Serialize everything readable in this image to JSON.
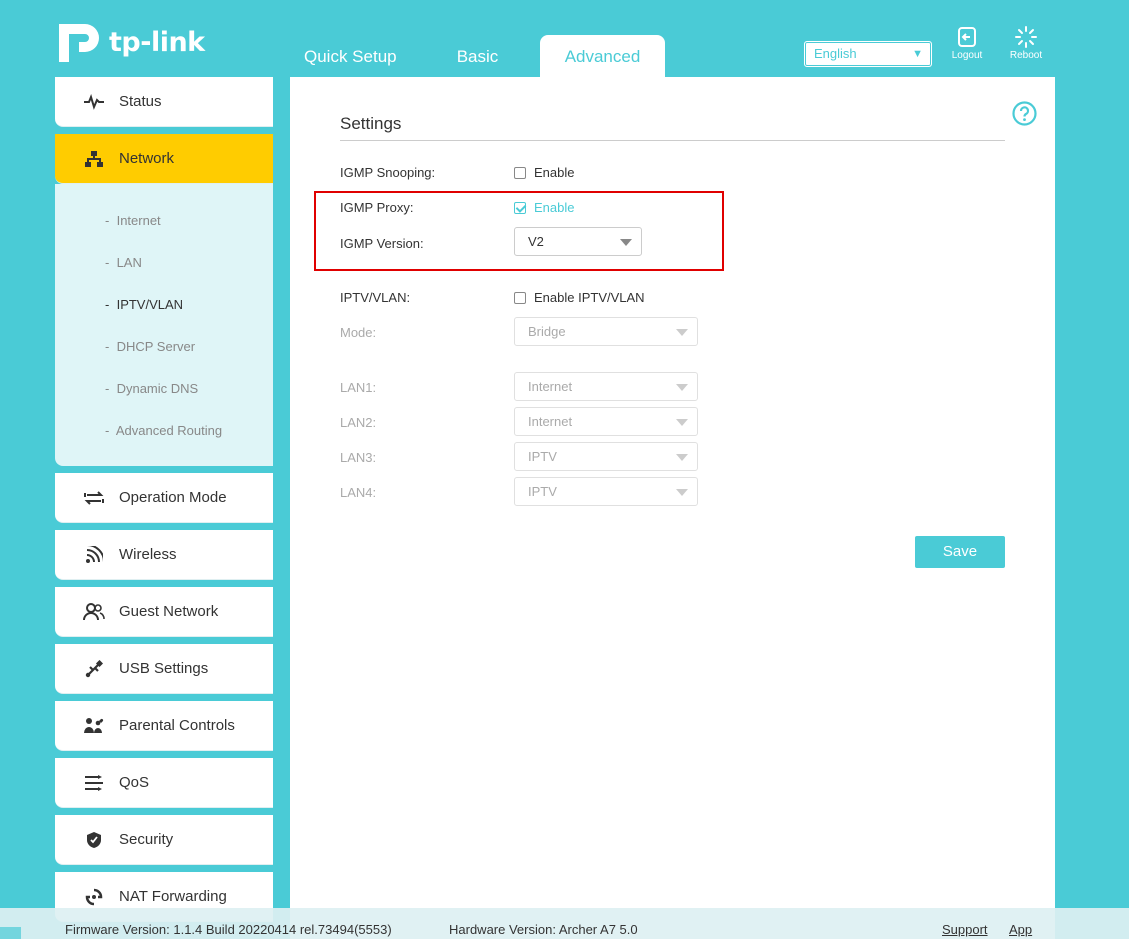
{
  "brand": {
    "name": "tp-link"
  },
  "tabs": [
    {
      "label": "Quick Setup"
    },
    {
      "label": "Basic"
    },
    {
      "label": "Advanced",
      "active": true
    }
  ],
  "header": {
    "language": "English",
    "logout": "Logout",
    "reboot": "Reboot"
  },
  "sidebar": {
    "items": [
      {
        "label": "Status",
        "icon": "pulse-icon"
      },
      {
        "label": "Network",
        "icon": "network-icon",
        "active": true
      },
      {
        "label": "Operation Mode",
        "icon": "operation-mode-icon"
      },
      {
        "label": "Wireless",
        "icon": "wifi-icon"
      },
      {
        "label": "Guest Network",
        "icon": "guest-icon"
      },
      {
        "label": "USB Settings",
        "icon": "usb-icon"
      },
      {
        "label": "Parental Controls",
        "icon": "parental-icon"
      },
      {
        "label": "QoS",
        "icon": "qos-icon"
      },
      {
        "label": "Security",
        "icon": "shield-icon"
      },
      {
        "label": "NAT Forwarding",
        "icon": "nat-icon"
      }
    ],
    "network_sub": [
      {
        "label": "Internet"
      },
      {
        "label": "LAN"
      },
      {
        "label": "IPTV/VLAN",
        "active": true
      },
      {
        "label": "DHCP Server"
      },
      {
        "label": "Dynamic DNS"
      },
      {
        "label": "Advanced Routing"
      }
    ],
    "sub_prefix": "-"
  },
  "settings": {
    "title": "Settings",
    "igmp_snooping": {
      "label": "IGMP Snooping:",
      "option": "Enable",
      "checked": false
    },
    "igmp_proxy": {
      "label": "IGMP Proxy:",
      "option": "Enable",
      "checked": true
    },
    "igmp_version": {
      "label": "IGMP Version:",
      "value": "V2"
    },
    "iptv_vlan": {
      "label": "IPTV/VLAN:",
      "option": "Enable IPTV/VLAN",
      "checked": false
    },
    "mode": {
      "label": "Mode:",
      "value": "Bridge"
    },
    "lan1": {
      "label": "LAN1:",
      "value": "Internet"
    },
    "lan2": {
      "label": "LAN2:",
      "value": "Internet"
    },
    "lan3": {
      "label": "LAN3:",
      "value": "IPTV"
    },
    "lan4": {
      "label": "LAN4:",
      "value": "IPTV"
    },
    "save": "Save"
  },
  "footer": {
    "firmware": "Firmware Version: 1.1.4 Build 20220414 rel.73494(5553)",
    "hardware": "Hardware Version: Archer A7 5.0",
    "support": "Support",
    "app": "App"
  },
  "colors": {
    "accent": "#4acbd6",
    "active_nav": "#ffcc00",
    "highlight": "#e00000"
  }
}
